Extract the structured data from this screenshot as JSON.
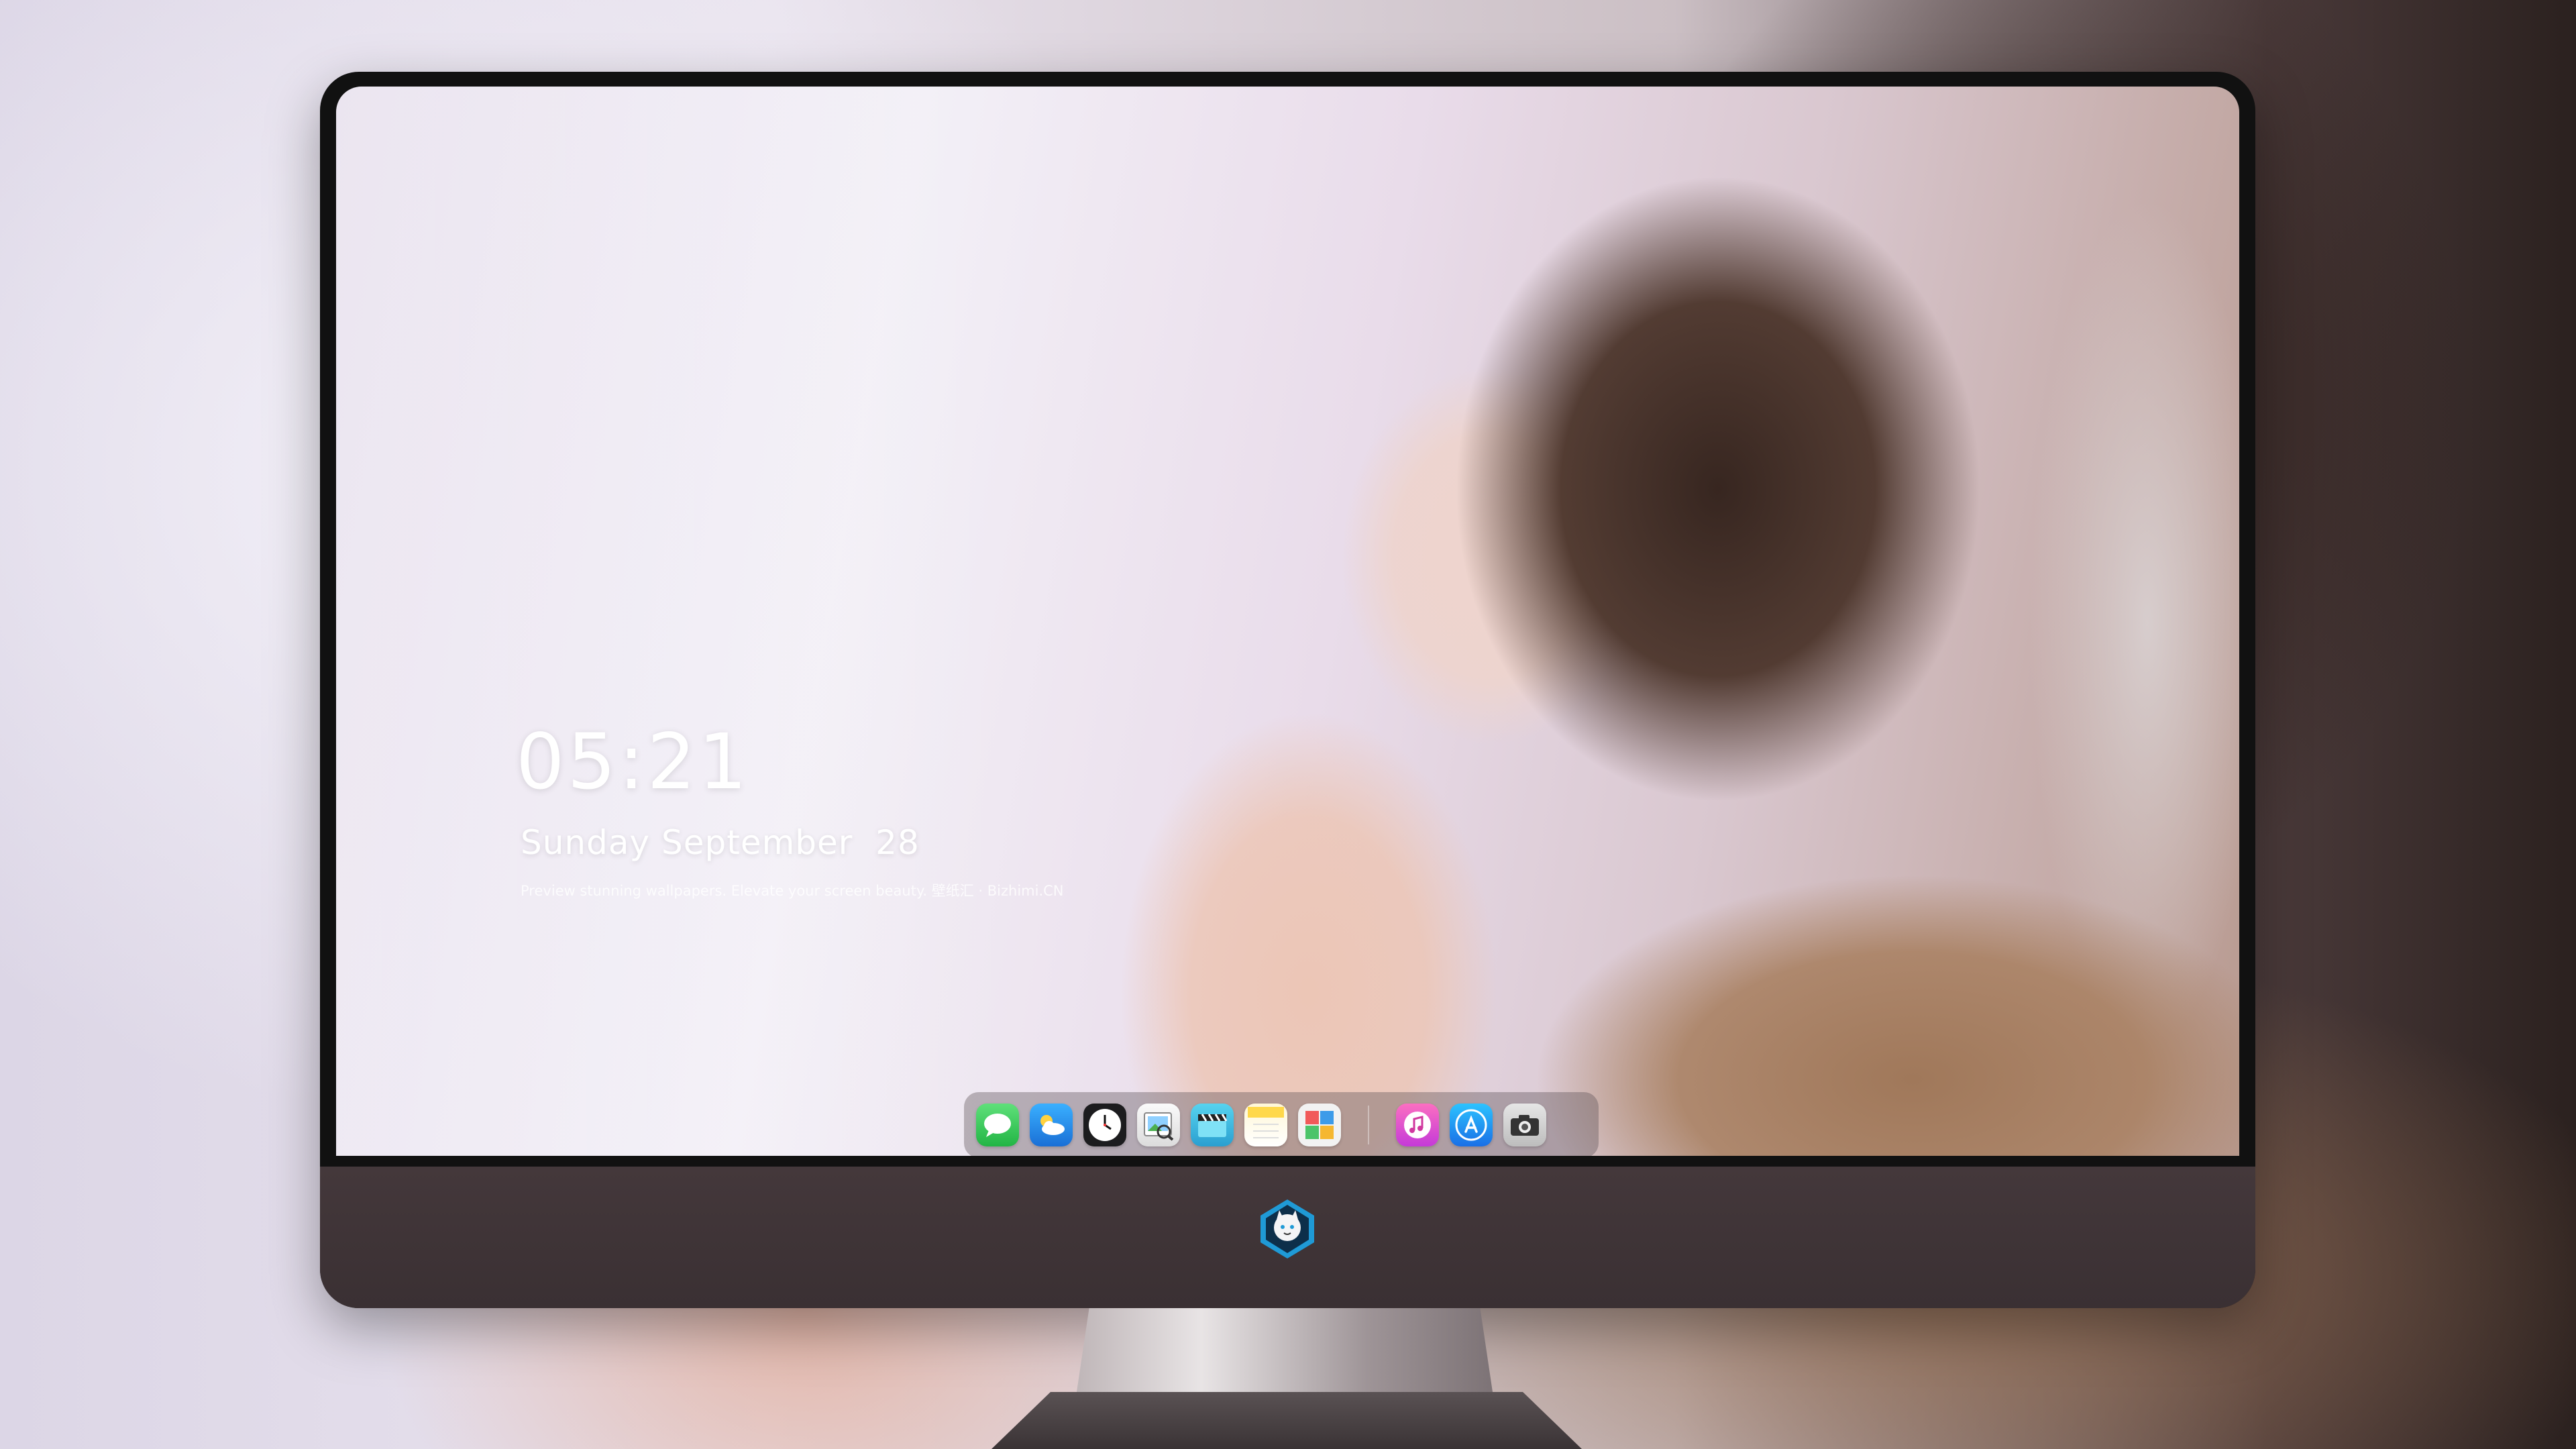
{
  "lockscreen": {
    "time": "05:21",
    "date": "Sunday September  28",
    "tagline": "Preview stunning wallpapers. Elevate your screen beauty. 壁纸汇 · Bizhimi.CN"
  },
  "dock": {
    "apps": [
      {
        "name": "Messages",
        "icon": "messages-icon",
        "color": "#34c759"
      },
      {
        "name": "Weather",
        "icon": "weather-icon",
        "color": "#2f9bf0"
      },
      {
        "name": "Clock",
        "icon": "clock-icon",
        "color": "#1c1c1e"
      },
      {
        "name": "Preview",
        "icon": "preview-icon",
        "color": "#f1f1f1"
      },
      {
        "name": "Clips",
        "icon": "clapperboard-icon",
        "color": "#3fc0e0"
      },
      {
        "name": "Notes",
        "icon": "notes-icon",
        "color": "#ffd84a"
      },
      {
        "name": "Photo Booth",
        "icon": "photo-grid-icon",
        "color": "#f2f2f2"
      },
      {
        "name": "iTunes",
        "icon": "music-note-icon",
        "color": "#f04ba0"
      },
      {
        "name": "App Store",
        "icon": "app-store-icon",
        "color": "#1f8cf5"
      },
      {
        "name": "Camera",
        "icon": "camera-icon",
        "color": "#cfcfcf"
      }
    ]
  },
  "bezel": {
    "logo": "white-cat-mascot-logo"
  }
}
